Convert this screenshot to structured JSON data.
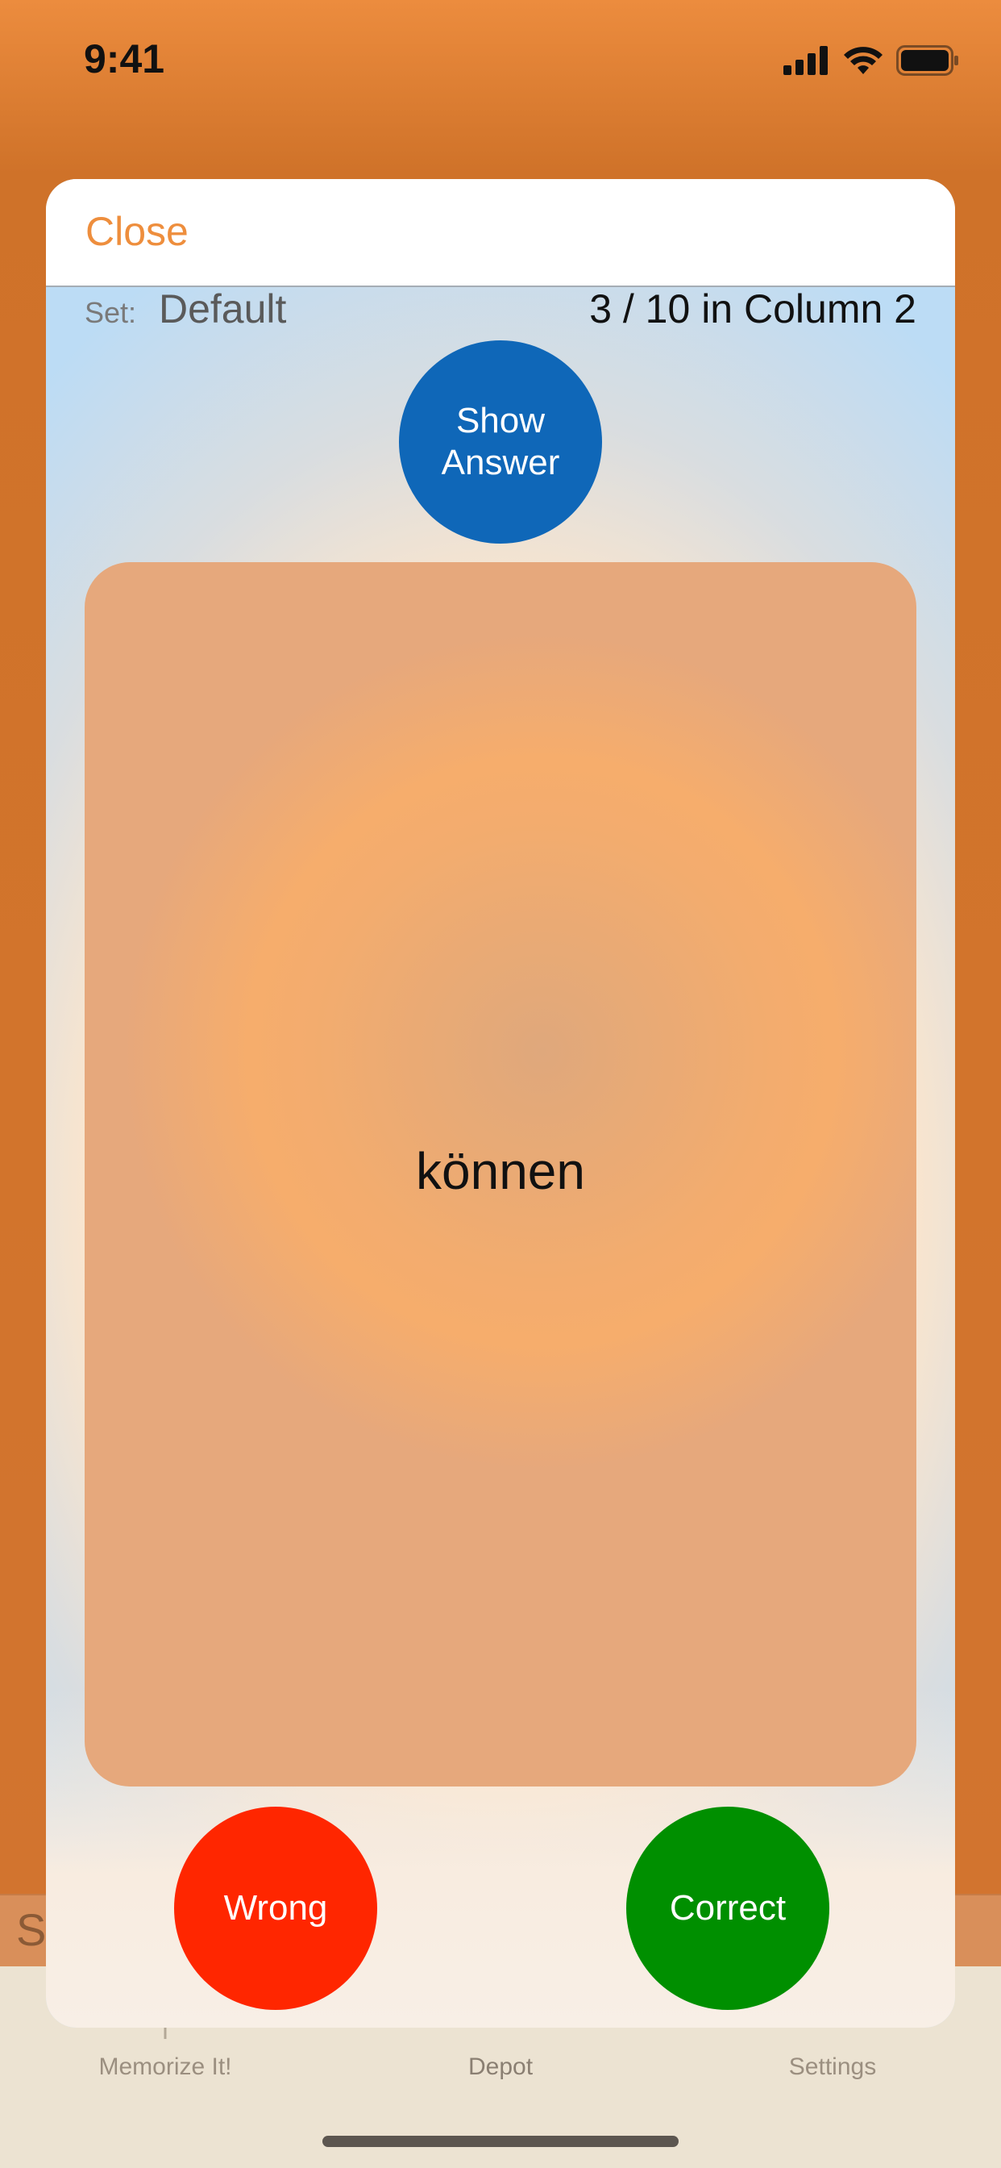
{
  "status_bar": {
    "time": "9:41"
  },
  "background_app": {
    "bar_text": "S",
    "tabs": [
      {
        "label": "Memorize It!"
      },
      {
        "label": "Depot"
      },
      {
        "label": "Settings"
      }
    ]
  },
  "sheet": {
    "close_label": "Close",
    "set_label": "Set:",
    "set_value": "Default",
    "progress": "3 / 10 in Column 2",
    "show_answer_label": "Show\nAnswer",
    "card_word": "können",
    "wrong_label": "Wrong",
    "correct_label": "Correct"
  },
  "colors": {
    "accent": "#ee8e3d",
    "show_answer": "#0f67b8",
    "wrong": "#ff2600",
    "correct": "#008f00",
    "card": "#f3ac6e"
  }
}
